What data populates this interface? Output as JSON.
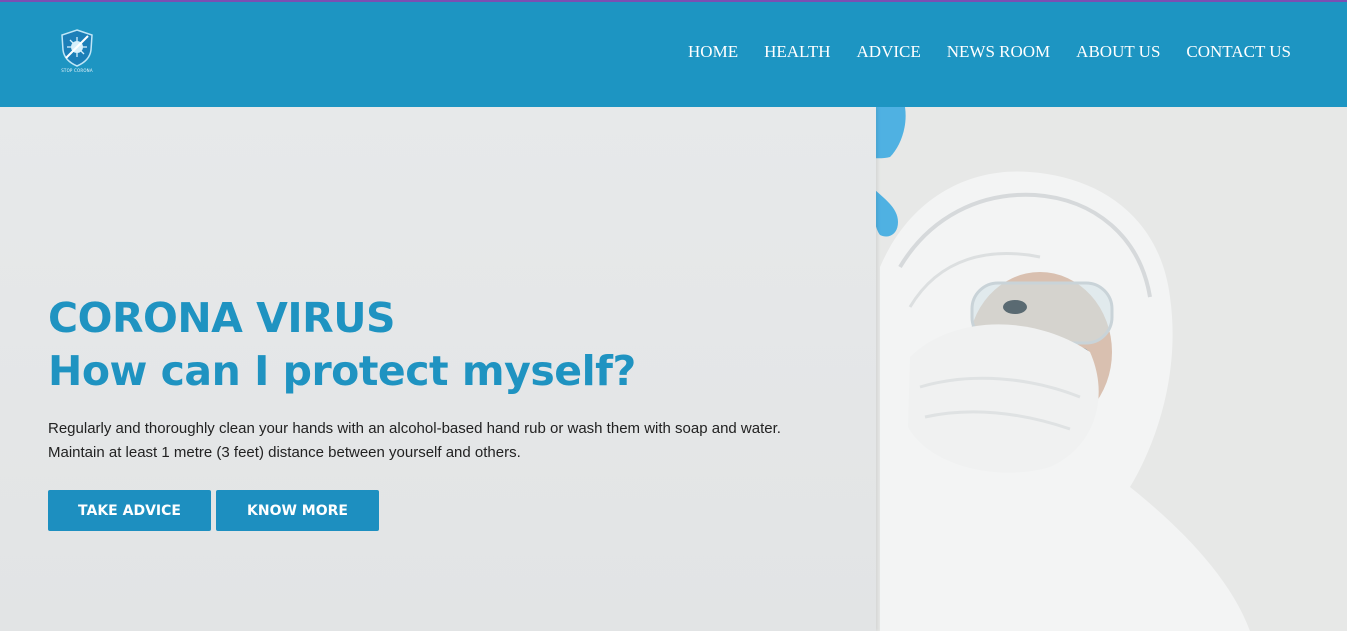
{
  "header": {
    "logo_text": "STOP CORONA",
    "nav": [
      "HOME",
      "HEALTH",
      "ADVICE",
      "NEWS ROOM",
      "ABOUT US",
      "CONTACT US"
    ]
  },
  "hero": {
    "title_line1": "CORONA VIRUS",
    "title_line2": "How can I protect myself?",
    "desc_line1": "Regularly and thoroughly clean your hands with an alcohol-based hand rub or wash them with soap and water.",
    "desc_line2": "Maintain at least 1 metre (3 feet) distance between yourself and others.",
    "btn_advice": "TAKE ADVICE",
    "btn_more": "KNOW MORE"
  },
  "colors": {
    "header_bg": "#1d95c2",
    "accent": "#1f93c1",
    "button_bg": "#1d8fc0",
    "top_border": "#7b4fb3"
  },
  "icons": [
    "shield-virus-icon"
  ]
}
